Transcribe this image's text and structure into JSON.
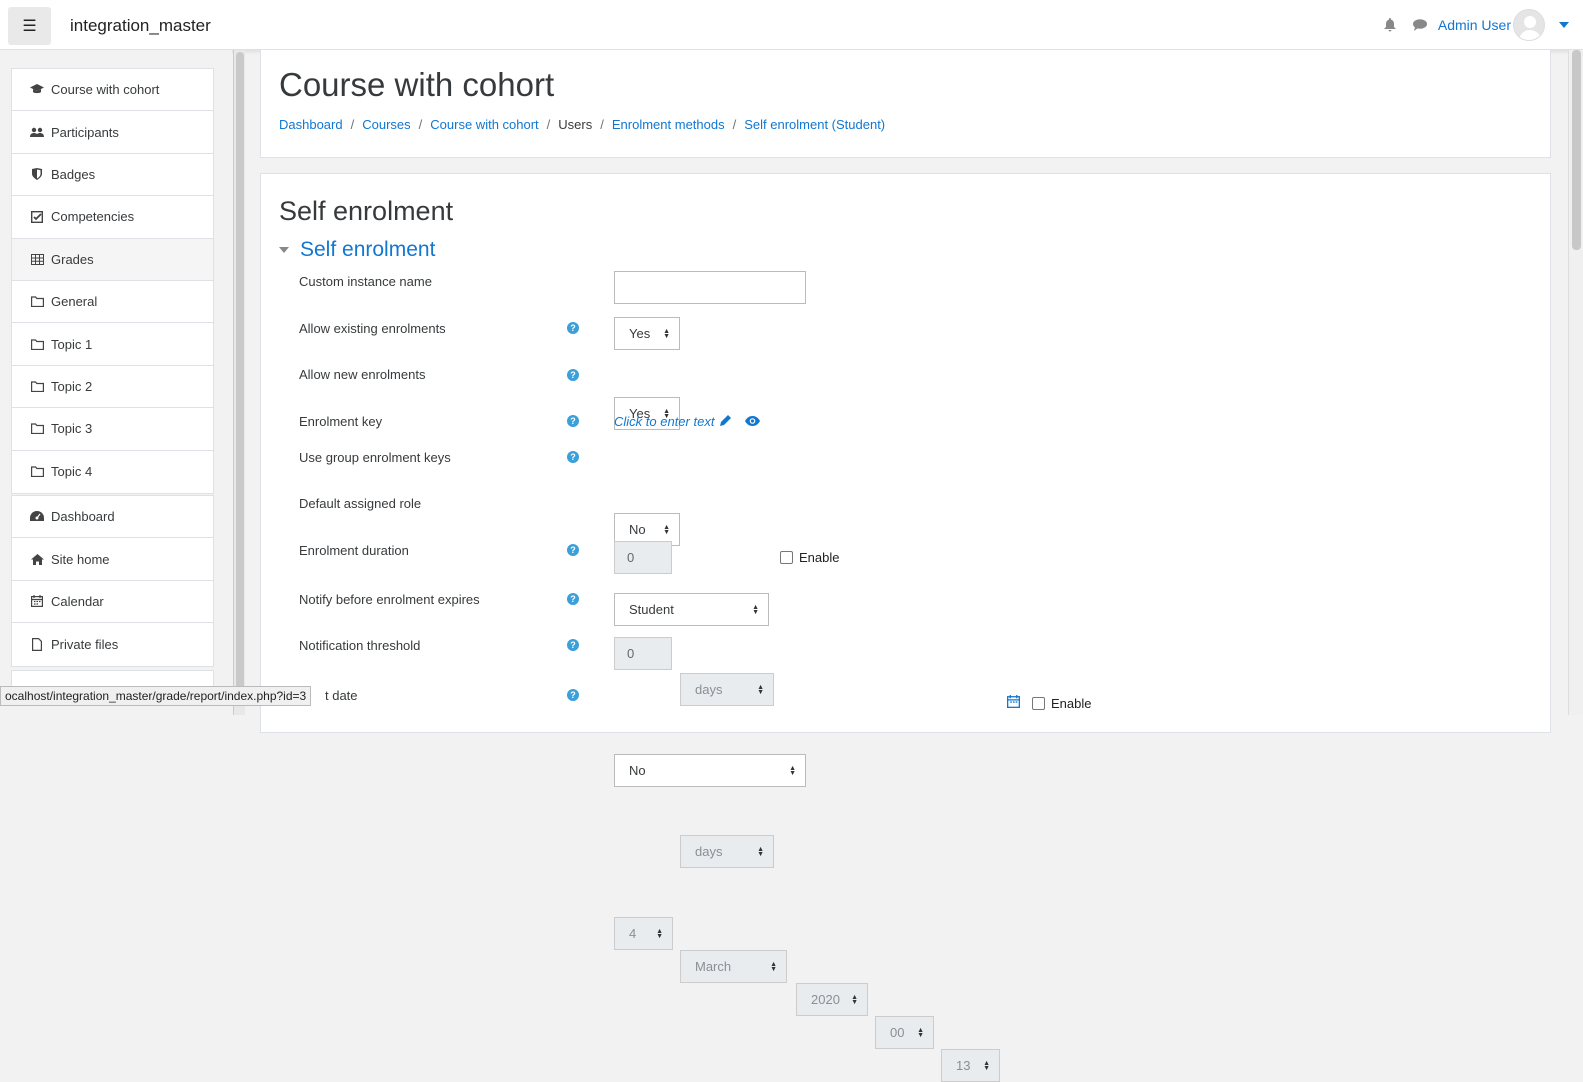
{
  "navbar": {
    "site_name": "integration_master",
    "user_name": "Admin User"
  },
  "drawer": {
    "course_items": [
      {
        "label": "Course with cohort",
        "icon": "graduation-cap-icon"
      },
      {
        "label": "Participants",
        "icon": "users-icon"
      },
      {
        "label": "Badges",
        "icon": "shield-icon"
      },
      {
        "label": "Competencies",
        "icon": "check-square-icon"
      },
      {
        "label": "Grades",
        "icon": "table-icon"
      },
      {
        "label": "General",
        "icon": "folder-icon"
      },
      {
        "label": "Topic 1",
        "icon": "folder-icon"
      },
      {
        "label": "Topic 2",
        "icon": "folder-icon"
      },
      {
        "label": "Topic 3",
        "icon": "folder-icon"
      },
      {
        "label": "Topic 4",
        "icon": "folder-icon"
      }
    ],
    "site_items": [
      {
        "label": "Dashboard",
        "icon": "dashboard-icon"
      },
      {
        "label": "Site home",
        "icon": "home-icon"
      },
      {
        "label": "Calendar",
        "icon": "calendar-icon"
      },
      {
        "label": "Private files",
        "icon": "file-icon"
      }
    ]
  },
  "header": {
    "title": "Course with cohort",
    "breadcrumb": [
      "Dashboard",
      "Courses",
      "Course with cohort",
      "Users",
      "Enrolment methods",
      "Self enrolment (Student)"
    ]
  },
  "form": {
    "title": "Self enrolment",
    "section": "Self enrolment",
    "fields": {
      "custom_name": {
        "label": "Custom instance name",
        "value": ""
      },
      "allow_existing": {
        "label": "Allow existing enrolments",
        "value": "Yes"
      },
      "allow_new": {
        "label": "Allow new enrolments",
        "value": "Yes"
      },
      "enrolment_key": {
        "label": "Enrolment key",
        "value": "Click to enter text"
      },
      "group_keys": {
        "label": "Use group enrolment keys",
        "value": "No"
      },
      "default_role": {
        "label": "Default assigned role",
        "value": "Student"
      },
      "duration": {
        "label": "Enrolment duration",
        "value": "0",
        "unit": "days",
        "enable": "Enable"
      },
      "notify": {
        "label": "Notify before enrolment expires",
        "value": "No"
      },
      "threshold": {
        "label": "Notification threshold",
        "value": "0",
        "unit": "days"
      },
      "start_date": {
        "label": "t date",
        "day": "4",
        "month": "March",
        "year": "2020",
        "hour": "00",
        "minute": "13",
        "enable": "Enable"
      }
    }
  },
  "status_url": "ocalhost/integration_master/grade/report/index.php?id=3"
}
